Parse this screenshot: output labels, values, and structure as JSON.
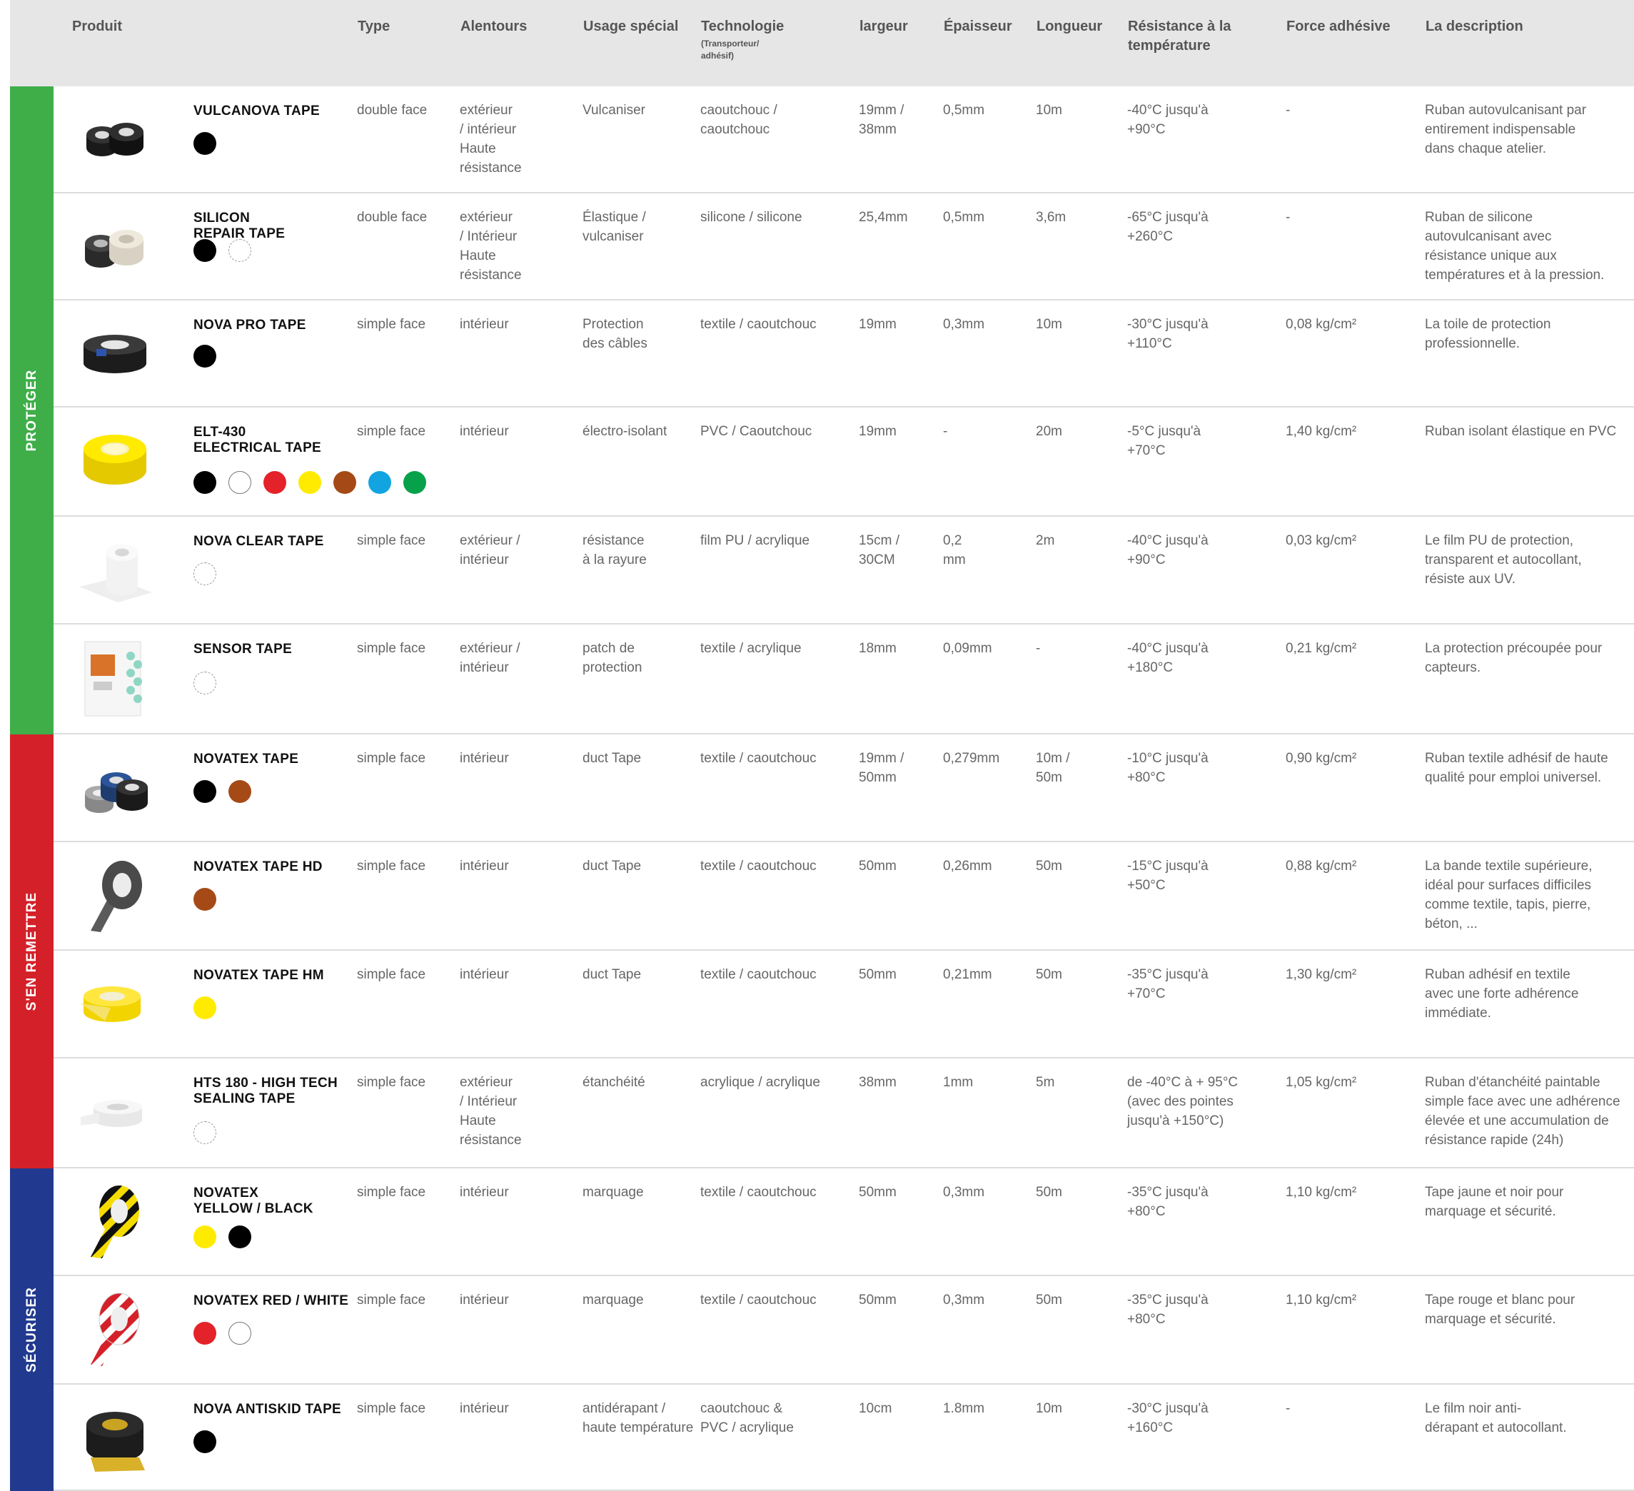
{
  "headers": {
    "product": "Produit",
    "type": "Type",
    "surroundings": "Alentours",
    "special_use": "Usage spécial",
    "technology": "Technologie",
    "technology_sub": "(Transporteur/\nadhésif)",
    "width": "largeur",
    "thickness": "Épaisseur",
    "length": "Longueur",
    "temperature": "Résistance à la\ntempérature",
    "adhesion": "Force adhésive",
    "description": "La description"
  },
  "categories": [
    {
      "label": "PROTÉGER",
      "color": "#3fae49"
    },
    {
      "label": "S'EN REMETTRE",
      "color": "#d42129"
    },
    {
      "label": "SÉCURISER",
      "color": "#213a8f"
    }
  ],
  "products": [
    {
      "name": "VULCANOVA TAPE",
      "image_icon": "black-tape-rolls-icon",
      "colors": [
        "#000000"
      ],
      "type": "double face",
      "surroundings": "extérieur\n/ intérieur\nHaute\nrésistance",
      "special_use": "Vulcaniser",
      "technology": "caoutchouc /\ncaoutchouc",
      "width": "19mm /\n38mm",
      "thickness": "0,5mm",
      "length": "10m",
      "temperature": "-40°C jusqu'à\n+90°C",
      "adhesion": "-",
      "description": "Ruban autovulcanisant par\nentirement indispensable\ndans chaque atelier."
    },
    {
      "name": "SILICON\nREPAIR TAPE",
      "image_icon": "silicone-tape-rolls-icon",
      "colors": [
        "#000000",
        "transparent"
      ],
      "type": "double face",
      "surroundings": "extérieur\n/ Intérieur\nHaute\nrésistance",
      "special_use": "Élastique /\nvulcaniser",
      "technology": "silicone / silicone",
      "width": "25,4mm",
      "thickness": "0,5mm",
      "length": "3,6m",
      "temperature": "-65°C jusqu'à\n+260°C",
      "adhesion": "-",
      "description": "Ruban de silicone\nautovulcanisant avec\nrésistance unique aux\ntempératures et à la pression."
    },
    {
      "name": "NOVA PRO TAPE",
      "image_icon": "black-cloth-tape-icon",
      "colors": [
        "#000000"
      ],
      "type": "simple face",
      "surroundings": "intérieur",
      "special_use": "Protection\ndes câbles",
      "technology": "textile / caoutchouc",
      "width": "19mm",
      "thickness": "0,3mm",
      "length": "10m",
      "temperature": "-30°C jusqu'à\n+110°C",
      "adhesion": "0,08 kg/cm²",
      "description": "La toile de protection\nprofessionnelle."
    },
    {
      "name": "ELT-430\nELECTRICAL TAPE",
      "image_icon": "yellow-electrical-tape-icon",
      "colors": [
        "#000000",
        "#ffffff",
        "#e42229",
        "#ffeb00",
        "#a54a17",
        "#12a4e1",
        "#07a14a"
      ],
      "type": "simple face",
      "surroundings": "intérieur",
      "special_use": "électro-isolant",
      "technology": "PVC / Caoutchouc",
      "width": "19mm",
      "thickness": "-",
      "length": "20m",
      "temperature": "-5°C jusqu'à\n+70°C",
      "adhesion": "1,40 kg/cm²",
      "description": "Ruban isolant élastique en PVC"
    },
    {
      "name": "NOVA CLEAR TAPE",
      "image_icon": "clear-film-roll-icon",
      "colors": [
        "transparent"
      ],
      "type": "simple face",
      "surroundings": "extérieur /\nintérieur",
      "special_use": "résistance\nà la rayure",
      "technology": "film PU / acrylique",
      "width": "15cm /\n30CM",
      "thickness": "0,2\nmm",
      "length": "2m",
      "temperature": "-40°C jusqu'à\n+90°C",
      "adhesion": "0,03 kg/cm²",
      "description": "Le film PU de protection,\ntransparent et autocollant,\nrésiste aux UV."
    },
    {
      "name": "SENSOR TAPE",
      "image_icon": "sensor-tape-pack-icon",
      "colors": [
        "transparent"
      ],
      "type": "simple face",
      "surroundings": "extérieur /\nintérieur",
      "special_use": "patch de\nprotection",
      "technology": "textile / acrylique",
      "width": "18mm",
      "thickness": "0,09mm",
      "length": "-",
      "temperature": "-40°C jusqu'à\n+180°C",
      "adhesion": "0,21 kg/cm²",
      "description": "La protection précoupée pour\ncapteurs."
    },
    {
      "name": "NOVATEX TAPE",
      "image_icon": "duct-tape-rolls-icon",
      "colors": [
        "#000000",
        "#a54a17"
      ],
      "type": "simple face",
      "surroundings": "intérieur",
      "special_use": "duct Tape",
      "technology": "textile / caoutchouc",
      "width": "19mm /\n50mm",
      "thickness": "0,279mm",
      "length": "10m /\n50m",
      "temperature": "-10°C jusqu'à\n+80°C",
      "adhesion": "0,90 kg/cm²",
      "description": "Ruban textile adhésif de haute\nqualité pour emploi universel."
    },
    {
      "name": "NOVATEX TAPE HD",
      "image_icon": "grey-duct-tape-icon",
      "colors": [
        "#a54a17"
      ],
      "type": "simple face",
      "surroundings": "intérieur",
      "special_use": "duct Tape",
      "technology": "textile / caoutchouc",
      "width": "50mm",
      "thickness": "0,26mm",
      "length": "50m",
      "temperature": "-15°C jusqu'à\n+50°C",
      "adhesion": "0,88 kg/cm²",
      "description": "La bande textile supérieure,\nidéal pour surfaces difficiles\ncomme textile, tapis, pierre,\nbéton, ..."
    },
    {
      "name": "NOVATEX TAPE HM",
      "image_icon": "yellow-duct-tape-icon",
      "colors": [
        "#ffeb00"
      ],
      "type": "simple face",
      "surroundings": "intérieur",
      "special_use": "duct Tape",
      "technology": "textile / caoutchouc",
      "width": "50mm",
      "thickness": "0,21mm",
      "length": "50m",
      "temperature": "-35°C jusqu'à\n+70°C",
      "adhesion": "1,30 kg/cm²",
      "description": "Ruban adhésif en textile\navec une forte adhérence\nimmédiate."
    },
    {
      "name": "HTS 180 - HIGH TECH\nSEALING TAPE",
      "image_icon": "white-sealing-tape-icon",
      "colors": [
        "transparent"
      ],
      "type": "simple face",
      "surroundings": "extérieur\n/ Intérieur\nHaute\nrésistance",
      "special_use": "étanchéité",
      "technology": "acrylique / acrylique",
      "width": "38mm",
      "thickness": "1mm",
      "length": "5m",
      "temperature": "de -40°C à + 95°C\n(avec des pointes\njusqu'à +150°C)",
      "adhesion": "1,05 kg/cm²",
      "description": "Ruban d'étanchéité paintable\nsimple face avec une adhérence\nélevée et une accumulation de\nrésistance rapide (24h)"
    },
    {
      "name": "NOVATEX\nYELLOW / BLACK",
      "image_icon": "yellow-black-marking-tape-icon",
      "colors": [
        "#ffeb00",
        "#000000"
      ],
      "type": "simple face",
      "surroundings": "intérieur",
      "special_use": "marquage",
      "technology": "textile / caoutchouc",
      "width": "50mm",
      "thickness": "0,3mm",
      "length": "50m",
      "temperature": "-35°C jusqu'à\n+80°C",
      "adhesion": "1,10 kg/cm²",
      "description": "Tape jaune et noir pour\nmarquage et sécurité."
    },
    {
      "name": "NOVATEX RED / WHITE",
      "image_icon": "red-white-marking-tape-icon",
      "colors": [
        "#e42229",
        "#ffffff"
      ],
      "type": "simple face",
      "surroundings": "intérieur",
      "special_use": "marquage",
      "technology": "textile / caoutchouc",
      "width": "50mm",
      "thickness": "0,3mm",
      "length": "50m",
      "temperature": "-35°C jusqu'à\n+80°C",
      "adhesion": "1,10 kg/cm²",
      "description": "Tape rouge et blanc pour\nmarquage et sécurité."
    },
    {
      "name": "NOVA ANTISKID TAPE",
      "image_icon": "antiskid-tape-roll-icon",
      "colors": [
        "#000000"
      ],
      "type": "simple face",
      "surroundings": "intérieur",
      "special_use": "antidérapant /\nhaute température",
      "technology": "caoutchouc &\nPVC / acrylique",
      "width": "10cm",
      "thickness": "1.8mm",
      "length": "10m",
      "temperature": "-30°C jusqu'à\n+160°C",
      "adhesion": "-",
      "description": "Le film noir anti-\ndérapant et autocollant."
    }
  ]
}
